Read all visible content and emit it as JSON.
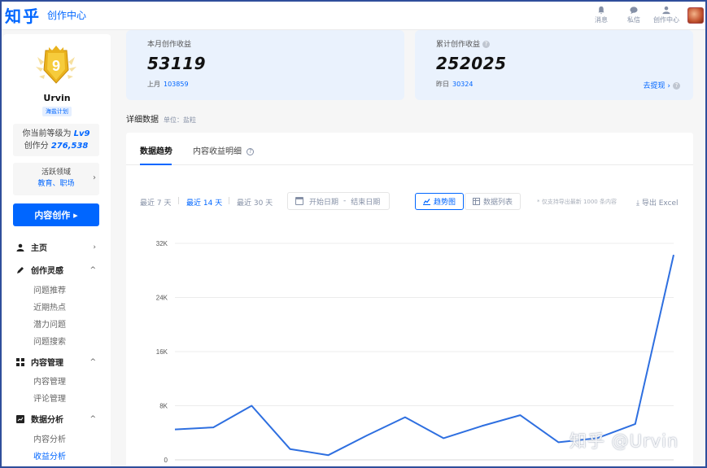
{
  "header": {
    "logo": "知乎",
    "subtitle": "创作中心",
    "actions": [
      {
        "label": "消息",
        "icon": "bell-icon"
      },
      {
        "label": "私信",
        "icon": "chat-icon"
      },
      {
        "label": "创作中心",
        "icon": "creator-icon"
      }
    ]
  },
  "sidebar": {
    "level_badge": "9",
    "username": "Urvin",
    "plan_tag": "海盐计划",
    "level_prefix": "你当前等级为",
    "level": "Lv9",
    "score_prefix": "创作分",
    "score": "276,538",
    "field_title": "活跃领域",
    "fields": "教育、职场",
    "create_button": "内容创作 ▸",
    "nav": [
      {
        "label": "主页",
        "icon": "user-icon",
        "arrow": "›",
        "children": []
      },
      {
        "label": "创作灵感",
        "icon": "pen-icon",
        "arrow": "^",
        "children": [
          "问题推荐",
          "近期热点",
          "潜力问题",
          "问题搜索"
        ]
      },
      {
        "label": "内容管理",
        "icon": "grid-icon",
        "arrow": "^",
        "children": [
          "内容管理",
          "评论管理"
        ]
      },
      {
        "label": "数据分析",
        "icon": "chart-icon",
        "arrow": "^",
        "children": [
          "内容分析",
          "收益分析"
        ]
      }
    ]
  },
  "cards": {
    "monthly": {
      "title": "本月创作收益",
      "value": "53119",
      "sub_label": "上月",
      "sub_value": "103859"
    },
    "total": {
      "title": "累计创作收益",
      "value": "252025",
      "sub_label": "昨日",
      "sub_value": "30324",
      "withdraw": "去提现 ›",
      "help": "?"
    }
  },
  "detail": {
    "title": "详细数据",
    "unit": "单位：盐粒",
    "tabs": [
      "数据趋势",
      "内容收益明细"
    ],
    "ranges": [
      "最近 7 天",
      "最近 14 天",
      "最近 30 天"
    ],
    "date_start": "开始日期",
    "date_sep": "-",
    "date_end": "结束日期",
    "view_trend": "趋势图",
    "view_list": "数据列表",
    "export_note": "* 仅支持导出最新 1000 条内容",
    "export": "导出 Excel"
  },
  "chart_data": {
    "type": "line",
    "title": "",
    "xlabel": "",
    "ylabel": "",
    "ylim": [
      0,
      32000
    ],
    "ytick_labels": [
      "0",
      "8K",
      "16K",
      "24K",
      "32K"
    ],
    "yticks": [
      0,
      8000,
      16000,
      24000,
      32000
    ],
    "grid": true,
    "series": [
      {
        "values": [
          4500,
          4800,
          8000,
          1600,
          700,
          3600,
          6300,
          3200,
          5000,
          6600,
          2600,
          3200,
          5300,
          30300
        ]
      }
    ],
    "color": "#2e6fe0"
  },
  "watermark": "知乎 @Urvin"
}
